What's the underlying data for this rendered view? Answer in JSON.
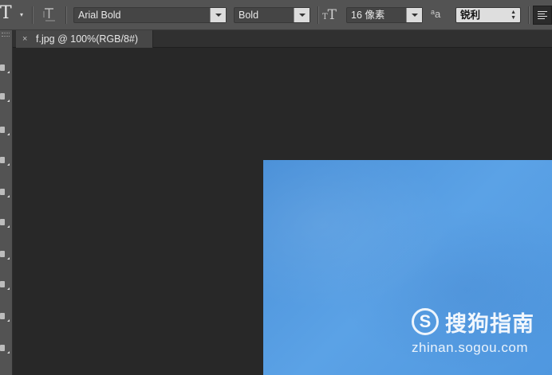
{
  "options_bar": {
    "tool_glyph": "T",
    "font_family": "Arial Bold",
    "font_style": "Bold",
    "font_size": "16 像素",
    "aa_glyph": "a",
    "aa_sub_glyph": "a",
    "antialias": "锐利",
    "size_icon_glyph": "T"
  },
  "tabs": [
    {
      "title": "f.jpg @ 100%(RGB/8#)",
      "close_glyph": "×"
    }
  ],
  "watermark": {
    "logo_glyph": "S",
    "brand": "搜狗指南",
    "url": "zhinan.sogou.com"
  },
  "colors": {
    "panel": "#535353",
    "workspace": "#282828",
    "image_blue": "#5ba2e6"
  }
}
